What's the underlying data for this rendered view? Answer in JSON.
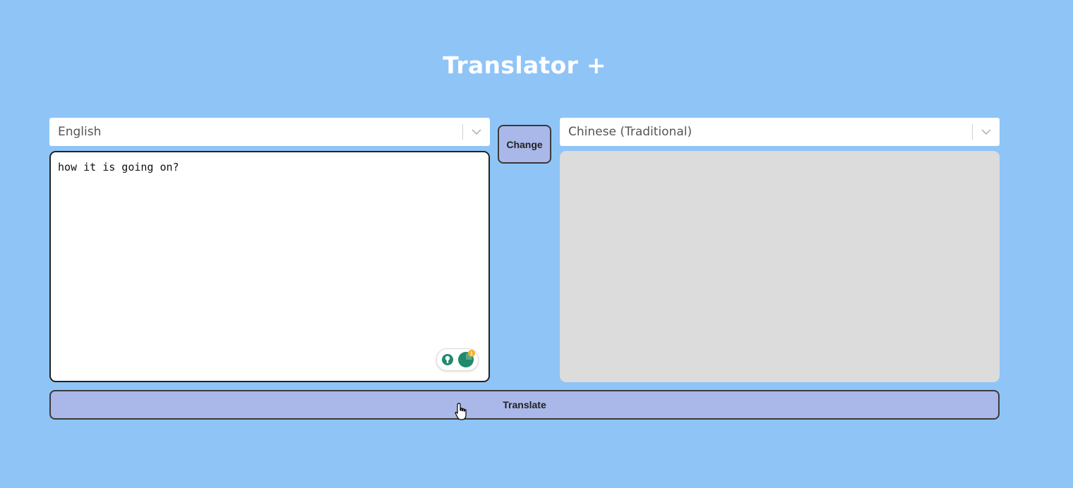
{
  "app": {
    "title": "Translator +"
  },
  "source": {
    "language": "English",
    "text": "how it is going on?"
  },
  "target": {
    "language": "Chinese (Traditional)",
    "text": ""
  },
  "buttons": {
    "change_label": "Change",
    "translate_label": "Translate"
  },
  "icons": {
    "dropdown": "chevron-down-icon",
    "grammar_widget": "grammarly-widget-icon",
    "cursor": "hand-pointer-icon"
  },
  "colors": {
    "background": "#8fc4f7",
    "button": "#a9b8e8",
    "output_box": "#dcdcdc",
    "widget_accent": "#1f8a6c",
    "badge": "#f2b01e"
  }
}
